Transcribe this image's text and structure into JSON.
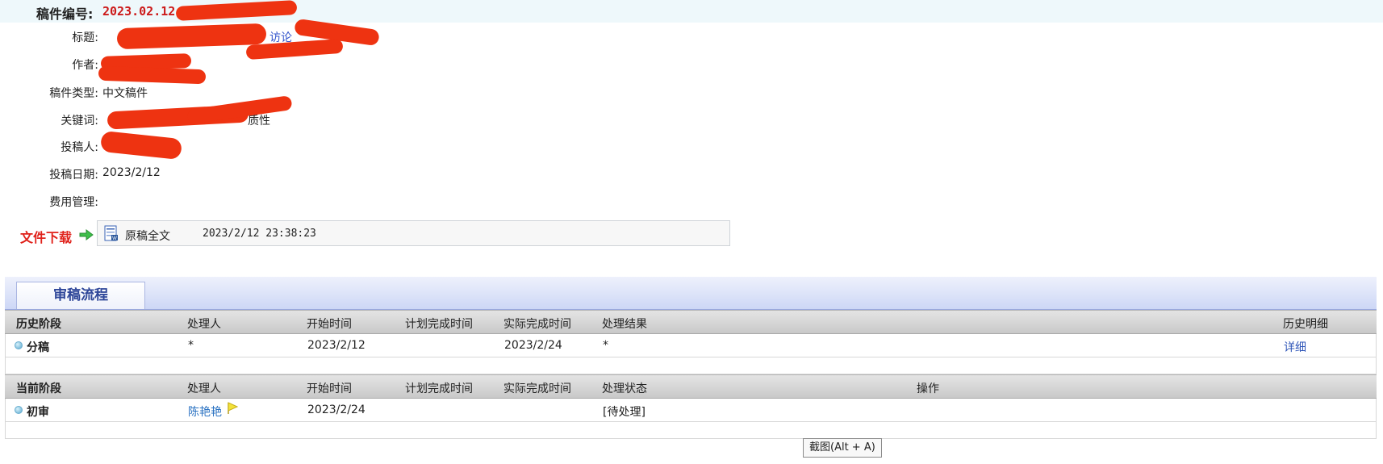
{
  "manuscript": {
    "number_label": "稿件编号:",
    "number_value": "2023.02.12.0"
  },
  "fields": [
    {
      "label": "标题:",
      "value": "访论"
    },
    {
      "label": "作者:",
      "value": ""
    },
    {
      "label": "稿件类型:",
      "value": "中文稿件"
    },
    {
      "label": "关键词:",
      "value": "质性"
    },
    {
      "label": "投稿人:",
      "value": ""
    },
    {
      "label": "投稿日期:",
      "value": "2023/2/12"
    },
    {
      "label": "费用管理:",
      "value": ""
    }
  ],
  "download": {
    "label": "文件下载",
    "file_name": "原稿全文",
    "file_date": "2023/2/12 23:38:23"
  },
  "review": {
    "tab_label": "审稿流程",
    "history": {
      "headers": [
        "历史阶段",
        "处理人",
        "开始时间",
        "计划完成时间",
        "实际完成时间",
        "处理结果",
        "历史明细"
      ],
      "rows": [
        {
          "stage": "分稿",
          "handler": "*",
          "start": "2023/2/12",
          "planned": "",
          "actual": "2023/2/24",
          "result": "*",
          "detail": "详细"
        }
      ]
    },
    "current": {
      "headers": [
        "当前阶段",
        "处理人",
        "开始时间",
        "计划完成时间",
        "实际完成时间",
        "处理状态",
        "操作"
      ],
      "rows": [
        {
          "stage": "初审",
          "handler": "陈艳艳",
          "start": "2023/2/24",
          "planned": "",
          "actual": "",
          "status": "[待处理]",
          "action": ""
        }
      ]
    }
  },
  "tooltip": "截图(Alt + A)",
  "colors": {
    "accent_red": "#e0221b",
    "header_blue": "#2f4799",
    "link_blue": "#2f56b8",
    "redaction": "#ee3311"
  },
  "icons": [
    "green-arrow-icon",
    "word-document-icon",
    "flag-icon",
    "bullet-dot-icon"
  ]
}
